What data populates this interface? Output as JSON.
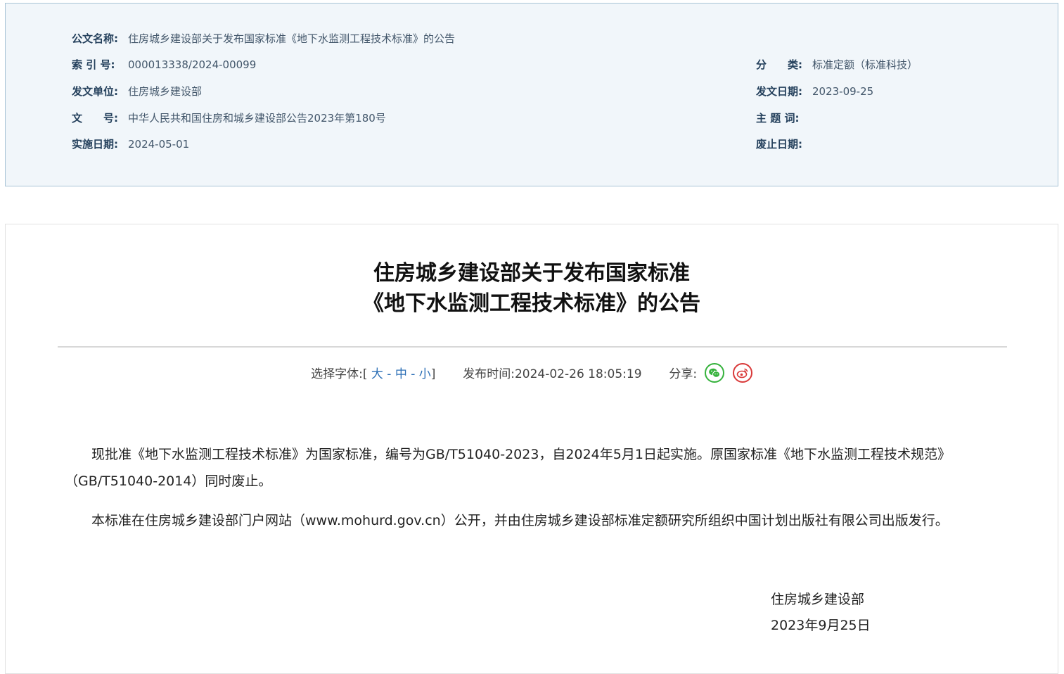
{
  "meta": {
    "title_label": "公文名称:",
    "title_value": "住房城乡建设部关于发布国家标准《地下水监测工程技术标准》的公告",
    "index_label": "索 引 号:",
    "index_value": "000013338/2024-00099",
    "category_label": "分　　类:",
    "category_value": "标准定额（标准科技）",
    "issuer_label": "发文单位:",
    "issuer_value": "住房城乡建设部",
    "issue_date_label": "发文日期:",
    "issue_date_value": "2023-09-25",
    "docno_label": "文　　号:",
    "docno_value": "中华人民共和国住房和城乡建设部公告2023年第180号",
    "subject_label": "主 题 词:",
    "subject_value": "",
    "effective_label": "实施日期:",
    "effective_value": "2024-05-01",
    "abolish_label": "废止日期:",
    "abolish_value": ""
  },
  "article": {
    "title_line1": "住房城乡建设部关于发布国家标准",
    "title_line2": "《地下水监测工程技术标准》的公告",
    "font_label": "选择字体:",
    "bracket_open": "[",
    "font_large": "大",
    "font_sep": "-",
    "font_medium": "中",
    "font_small": "小",
    "bracket_close": "]",
    "publish_label": "发布时间:",
    "publish_time": "2024-02-26 18:05:19",
    "share_label": "分享:",
    "para1": "现批准《地下水监测工程技术标准》为国家标准，编号为GB/T51040-2023，自2024年5月1日起实施。原国家标准《地下水监测工程技术规范》（GB/T51040-2014）同时废止。",
    "para2": "本标准在住房城乡建设部门户网站（www.mohurd.gov.cn）公开，并由住房城乡建设部标准定额研究所组织中国计划出版社有限公司出版发行。",
    "sign_org": "住房城乡建设部",
    "sign_date": "2023年9月25日"
  },
  "colors": {
    "meta_bg": "#f1f6fa",
    "meta_border": "#a9c4d6",
    "link": "#2c6fb6",
    "wechat": "#35b23c",
    "weibo": "#d93a3a"
  },
  "icons": [
    "wechat-icon",
    "weibo-icon"
  ]
}
